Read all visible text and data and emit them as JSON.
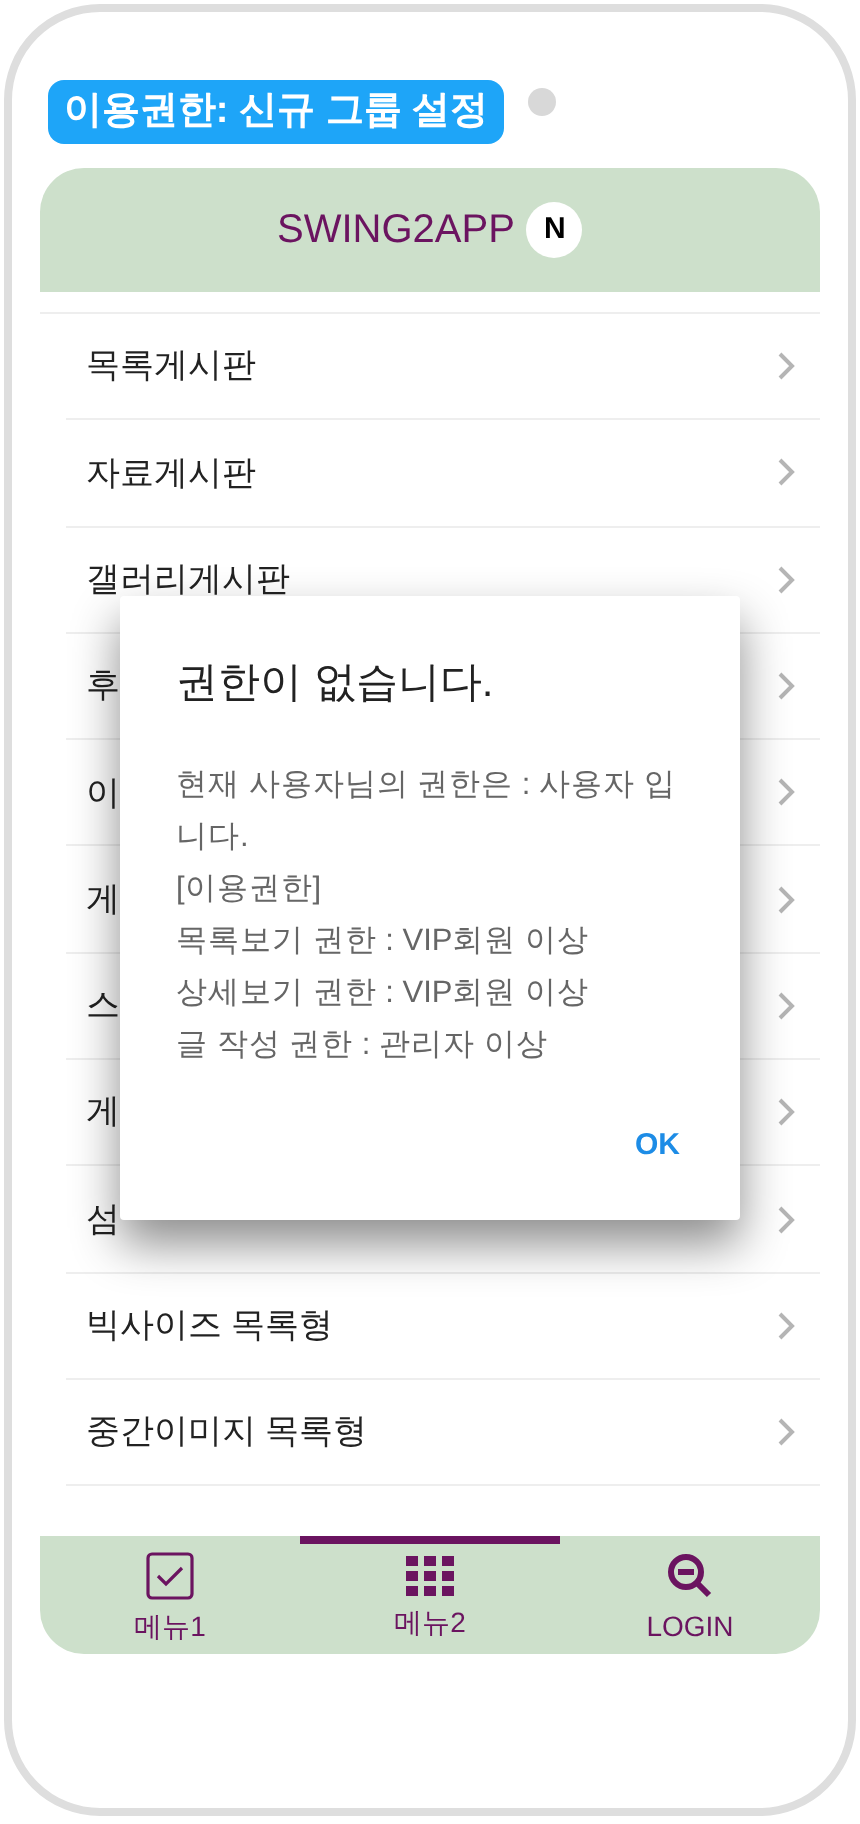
{
  "badge": "이용권한: 신규 그룹 설정",
  "header": {
    "title": "SWING2APP",
    "notice": "N"
  },
  "menu_items": [
    "목록게시판",
    "자료게시판",
    "갤러리게시판",
    "후",
    "이",
    "게",
    "스",
    "게",
    "섬",
    "빅사이즈 목록형",
    "중간이미지 목록형"
  ],
  "dialog": {
    "title": "권한이 없습니다.",
    "message": [
      "현재 사용자님의 권한은 : 사용자 입니다.",
      "[이용권한]",
      "목록보기 권한 : VIP회원 이상",
      "상세보기 권한 : VIP회원 이상",
      "글 작성 권한 : 관리자 이상"
    ],
    "button": "OK"
  },
  "bottom_nav": [
    {
      "label": "메뉴1",
      "selected": false
    },
    {
      "label": "메뉴2",
      "selected": true
    },
    {
      "label": "LOGIN",
      "selected": false
    }
  ]
}
